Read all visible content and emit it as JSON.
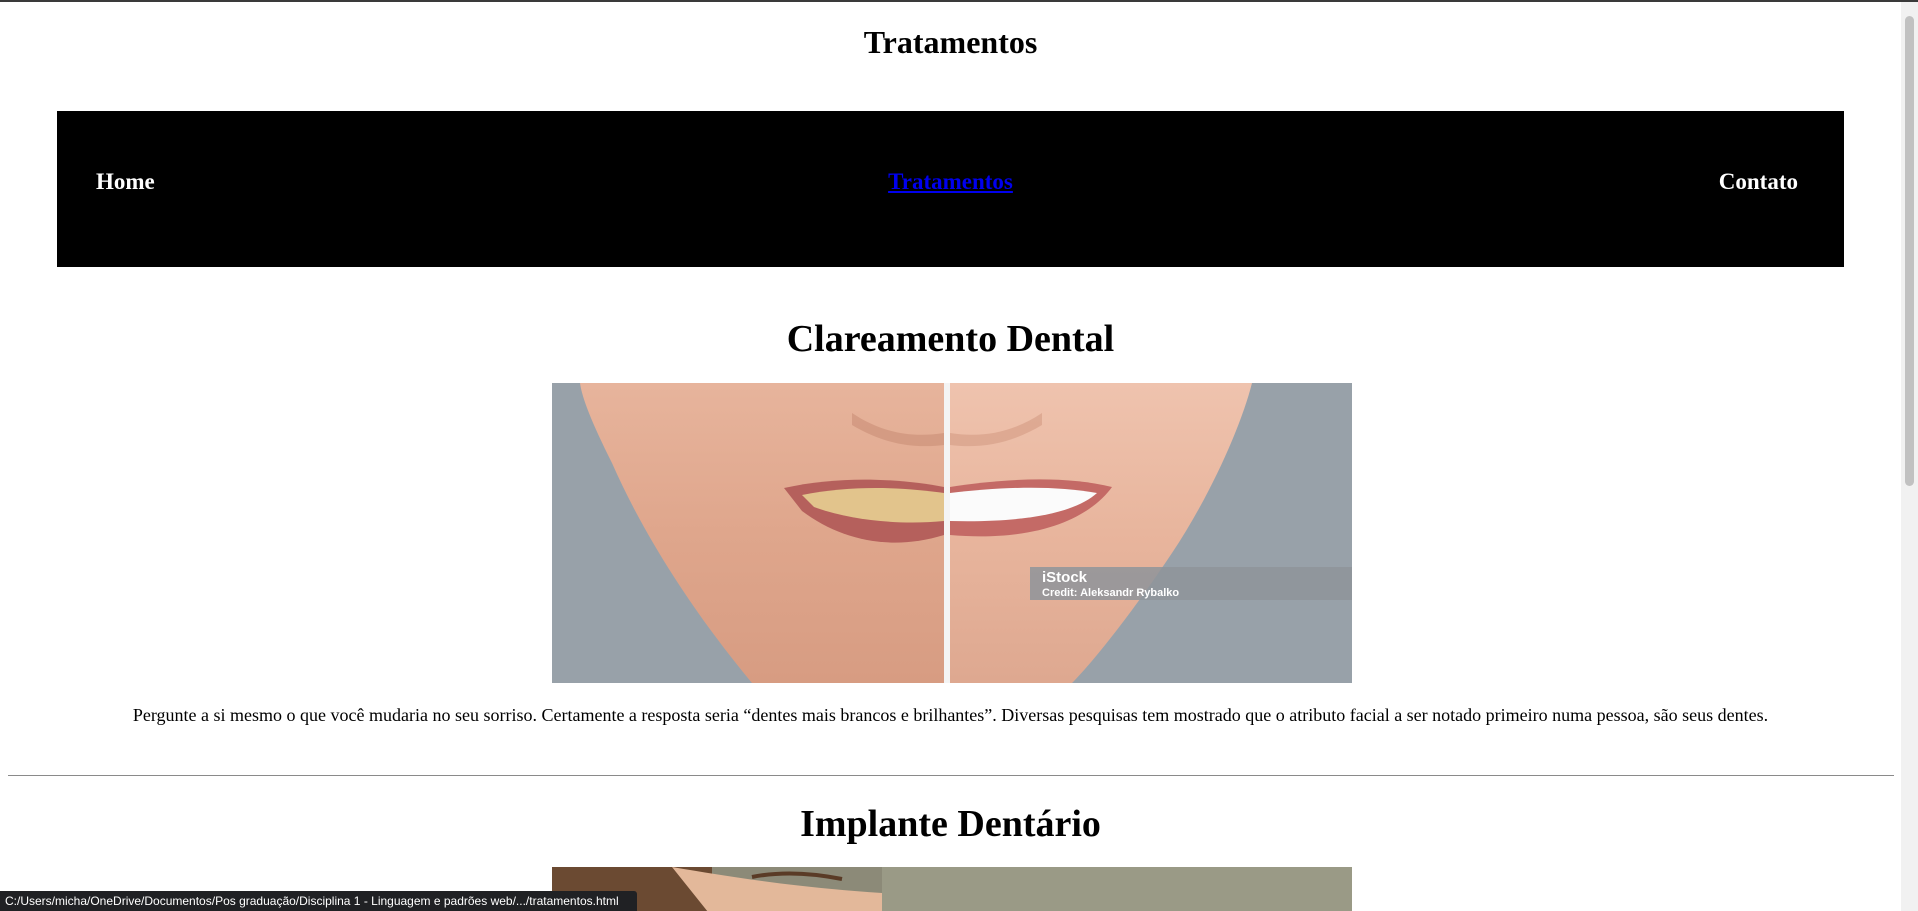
{
  "page": {
    "title": "Tratamentos"
  },
  "nav": {
    "items": [
      {
        "label": "Home",
        "active": false
      },
      {
        "label": "Tratamentos",
        "active": true
      },
      {
        "label": "Contato",
        "active": false
      }
    ]
  },
  "sections": [
    {
      "title": "Clareamento Dental",
      "image": {
        "watermark_brand": "iStock",
        "watermark_credit": "Credit: Aleksandr Rybalko"
      },
      "description": "Pergunte a si mesmo o que você mudaria no seu sorriso. Certamente a resposta seria “dentes mais brancos e brilhantes”. Diversas pesquisas tem mostrado que o atributo facial a ser notado primeiro numa pessoa, são seus dentes."
    },
    {
      "title": "Implante Dentário"
    }
  ],
  "status_bar": {
    "text": "C:/Users/micha/OneDrive/Documentos/Pos graduação/Disciplina 1 - Linguagem e padrões web/.../tratamentos.html"
  },
  "colors": {
    "nav_background": "#000000",
    "nav_link": "#ffffff",
    "nav_link_active": "#0000ee"
  }
}
